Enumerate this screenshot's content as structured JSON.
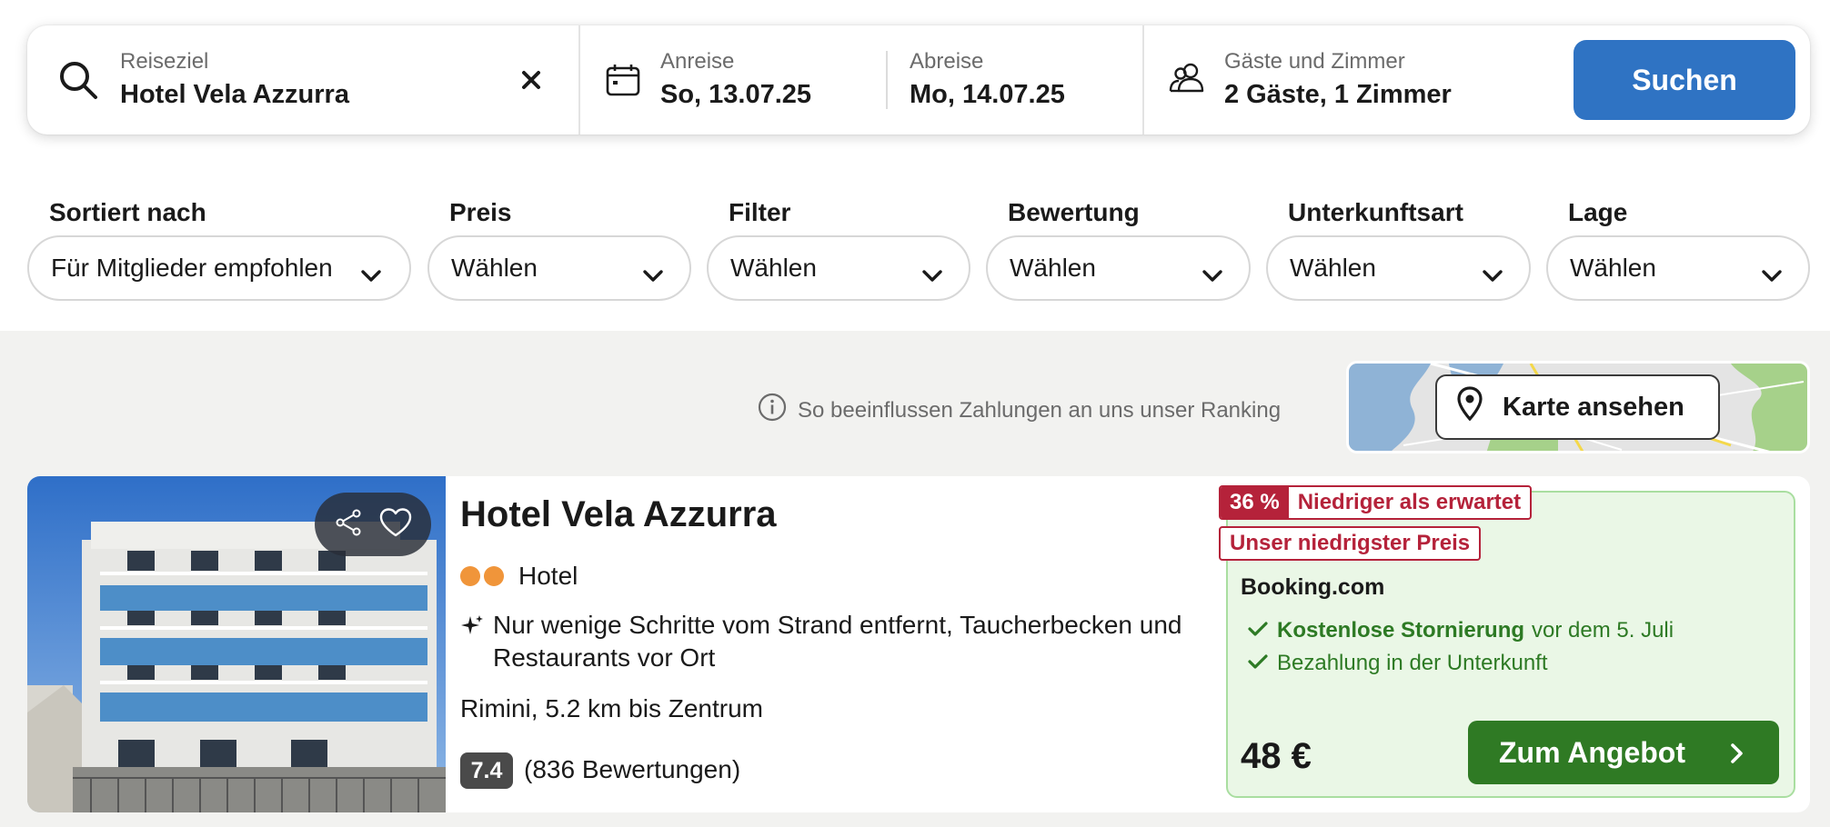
{
  "search": {
    "destination_label": "Reiseziel",
    "destination_value": "Hotel Vela Azzurra",
    "checkin_label": "Anreise",
    "checkin_value": "So, 13.07.25",
    "checkout_label": "Abreise",
    "checkout_value": "Mo, 14.07.25",
    "guests_label": "Gäste und Zimmer",
    "guests_value": "2 Gäste, 1 Zimmer",
    "search_button": "Suchen",
    "accent_color": "#2f73c3"
  },
  "filters": [
    {
      "label": "Sortiert nach",
      "value": "Für Mitglieder empfohlen"
    },
    {
      "label": "Preis",
      "value": "Wählen"
    },
    {
      "label": "Filter",
      "value": "Wählen"
    },
    {
      "label": "Bewertung",
      "value": "Wählen"
    },
    {
      "label": "Unterkunftsart",
      "value": "Wählen"
    },
    {
      "label": "Lage",
      "value": "Wählen"
    }
  ],
  "ranking_note": "So beeinflussen Zahlungen an uns unser Ranking",
  "map_button": "Karte ansehen",
  "result": {
    "name": "Hotel Vela Azzurra",
    "star_dots": 2,
    "type": "Hotel",
    "description": "Nur wenige Schritte vom Strand entfernt, Taucherbecken und Restaurants vor Ort",
    "location": "Rimini, 5.2 km bis Zentrum",
    "score": "7.4",
    "reviews": "(836 Bewertungen)",
    "badge_percent": "36 %",
    "badge_text": "Niedriger als erwartet",
    "badge_lowest": "Unser niedrigster Preis",
    "provider": "Booking.com",
    "perk1_bold": "Kostenlose Stornierung",
    "perk1_rest": "vor dem 5. Juli",
    "perk2": "Bezahlung in der Unterkunft",
    "price": "48 €",
    "cta": "Zum Angebot",
    "deal_color": "#b5223a",
    "cta_color": "#2f7a24"
  }
}
